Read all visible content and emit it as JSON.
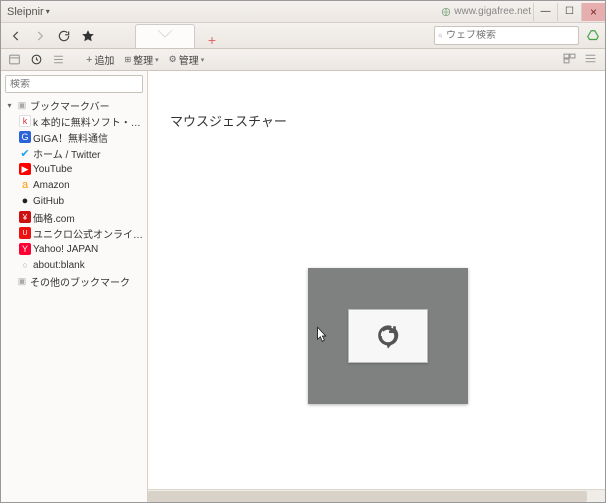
{
  "app": {
    "name": "Sleipnir"
  },
  "url": "www.gigafree.net",
  "window": {
    "minimize": "—",
    "maximize": "☐",
    "close": "×"
  },
  "tabs": {
    "newTab": "+"
  },
  "webSearch": {
    "placeholder": "ウェブ検索"
  },
  "bmActions": {
    "add": "追加",
    "organize": "整理",
    "manage": "管理"
  },
  "sidebarSearch": {
    "placeholder": "検索"
  },
  "tree": {
    "root": {
      "label": "ブックマークバー"
    },
    "items": [
      {
        "label": "k 本的に無料ソフト・フリーソフト"
      },
      {
        "label": "GIGA！無料通信"
      },
      {
        "label": "ホーム / Twitter"
      },
      {
        "label": "YouTube"
      },
      {
        "label": "Amazon"
      },
      {
        "label": "GitHub"
      },
      {
        "label": "価格.com"
      },
      {
        "label": "ユニクロ公式オンラインストア"
      },
      {
        "label": "Yahoo! JAPAN"
      },
      {
        "label": "about:blank"
      }
    ],
    "other": {
      "label": "その他のブックマーク"
    }
  },
  "page": {
    "heading": "マウスジェスチャー"
  },
  "gesture": {
    "action": "reload"
  }
}
